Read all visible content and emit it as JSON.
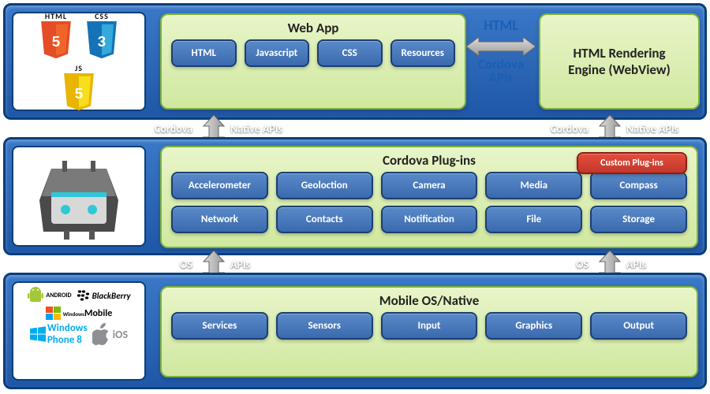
{
  "top": {
    "webapp": {
      "title": "Web App",
      "items": [
        "HTML",
        "Javascript",
        "CSS",
        "Resources"
      ]
    },
    "webview_title_l1": "HTML Rendering",
    "webview_title_l2": "Engine (WebView)",
    "connector_line1": "HTML",
    "connector_line2": "Cordova",
    "connector_line3": "APIs",
    "badges": {
      "html": "HTML",
      "css": "CSS",
      "js": "JS",
      "five": "5",
      "three": "3"
    }
  },
  "arrow_top_left": {
    "left": "Cordova",
    "right": "Native APIs"
  },
  "arrow_top_right": {
    "left": "Cordova",
    "right": "Native APIs"
  },
  "mid": {
    "title": "Cordova Plug-ins",
    "custom": "Custom Plug-ins",
    "row1": [
      "Accelerometer",
      "Geoloction",
      "Camera",
      "Media",
      "Compass"
    ],
    "row2": [
      "Network",
      "Contacts",
      "Notification",
      "File",
      "Storage"
    ]
  },
  "arrow_bot_left": {
    "left": "OS",
    "right": "APIs"
  },
  "arrow_bot_right": {
    "left": "OS",
    "right": "APIs"
  },
  "bot": {
    "title": "Mobile OS/Native",
    "items": [
      "Services",
      "Sensors",
      "Input",
      "Graphics",
      "Output"
    ],
    "platforms": {
      "android": "ANDROID",
      "blackberry": "BlackBerry",
      "winmobile": "Mobile",
      "winmobile_pre": "Windows",
      "wp8_l1": "Windows",
      "wp8_l2": "Phone 8",
      "ios": "iOS"
    }
  }
}
